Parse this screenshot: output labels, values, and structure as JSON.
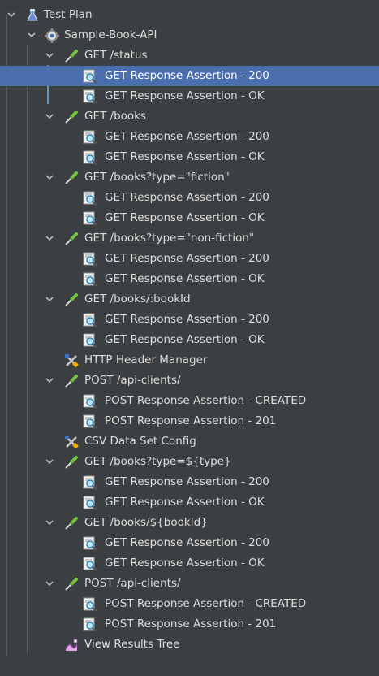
{
  "colors": {
    "background": "#3c3f41",
    "selection": "#4b6eaf",
    "text": "#dcdcdc",
    "guide": "#5a5d5f"
  },
  "tree": [
    {
      "label": "Test Plan",
      "icon": "flask-icon",
      "level": 0,
      "expandable": true
    },
    {
      "label": "Sample-Book-API",
      "icon": "thread-group-gear-icon",
      "level": 1,
      "expandable": true
    },
    {
      "label": "GET /status",
      "icon": "pipette-sampler-icon",
      "level": 2,
      "expandable": true
    },
    {
      "label": "GET Response Assertion - 200",
      "icon": "assertion-magnifier-icon",
      "level": 3,
      "selected": true
    },
    {
      "label": "GET Response Assertion - OK",
      "icon": "assertion-magnifier-icon",
      "level": 3
    },
    {
      "label": "GET /books",
      "icon": "pipette-sampler-icon",
      "level": 2,
      "expandable": true
    },
    {
      "label": "GET Response Assertion - 200",
      "icon": "assertion-magnifier-icon",
      "level": 3
    },
    {
      "label": "GET Response Assertion - OK",
      "icon": "assertion-magnifier-icon",
      "level": 3
    },
    {
      "label": "GET /books?type=\"fiction\"",
      "icon": "pipette-sampler-icon",
      "level": 2,
      "expandable": true
    },
    {
      "label": "GET Response Assertion - 200",
      "icon": "assertion-magnifier-icon",
      "level": 3
    },
    {
      "label": "GET Response Assertion - OK",
      "icon": "assertion-magnifier-icon",
      "level": 3
    },
    {
      "label": "GET /books?type=\"non-fiction\"",
      "icon": "pipette-sampler-icon",
      "level": 2,
      "expandable": true
    },
    {
      "label": "GET Response Assertion - 200",
      "icon": "assertion-magnifier-icon",
      "level": 3
    },
    {
      "label": "GET Response Assertion - OK",
      "icon": "assertion-magnifier-icon",
      "level": 3
    },
    {
      "label": "GET /books/:bookId",
      "icon": "pipette-sampler-icon",
      "level": 2,
      "expandable": true
    },
    {
      "label": "GET Response Assertion - 200",
      "icon": "assertion-magnifier-icon",
      "level": 3
    },
    {
      "label": "GET Response Assertion - OK",
      "icon": "assertion-magnifier-icon",
      "level": 3
    },
    {
      "label": "HTTP Header Manager",
      "icon": "config-tools-icon",
      "level": 2
    },
    {
      "label": "POST /api-clients/",
      "icon": "pipette-sampler-icon",
      "level": 2,
      "expandable": true
    },
    {
      "label": "POST Response Assertion - CREATED",
      "icon": "assertion-magnifier-icon",
      "level": 3
    },
    {
      "label": "POST Response Assertion - 201",
      "icon": "assertion-magnifier-icon",
      "level": 3
    },
    {
      "label": "CSV Data Set Config",
      "icon": "config-tools-icon",
      "level": 2
    },
    {
      "label": "GET /books?type=${type}",
      "icon": "pipette-sampler-icon",
      "level": 2,
      "expandable": true
    },
    {
      "label": "GET Response Assertion - 200",
      "icon": "assertion-magnifier-icon",
      "level": 3
    },
    {
      "label": "GET Response Assertion - OK",
      "icon": "assertion-magnifier-icon",
      "level": 3
    },
    {
      "label": "GET /books/${bookId}",
      "icon": "pipette-sampler-icon",
      "level": 2,
      "expandable": true
    },
    {
      "label": "GET Response Assertion - 200",
      "icon": "assertion-magnifier-icon",
      "level": 3
    },
    {
      "label": "GET Response Assertion - OK",
      "icon": "assertion-magnifier-icon",
      "level": 3
    },
    {
      "label": "POST /api-clients/",
      "icon": "pipette-sampler-icon",
      "level": 2,
      "expandable": true
    },
    {
      "label": "POST Response Assertion - CREATED",
      "icon": "assertion-magnifier-icon",
      "level": 3
    },
    {
      "label": "POST Response Assertion - 201",
      "icon": "assertion-magnifier-icon",
      "level": 3
    },
    {
      "label": "View Results Tree",
      "icon": "results-tree-icon",
      "level": 2
    }
  ]
}
